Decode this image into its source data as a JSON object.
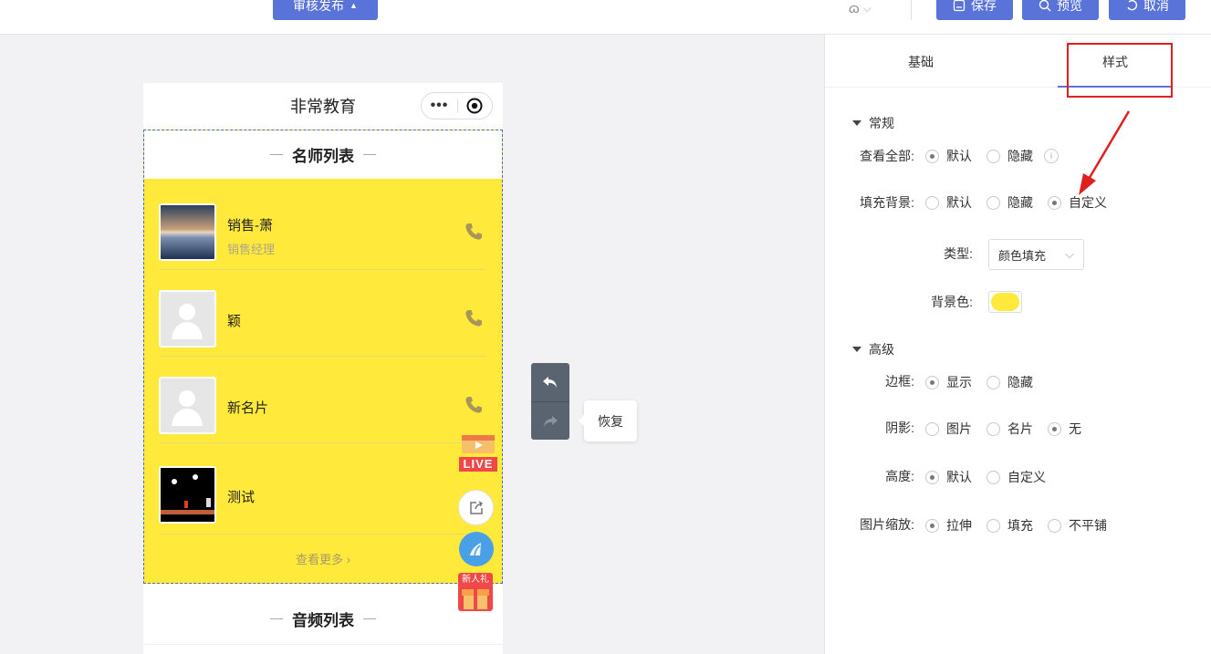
{
  "topbar": {
    "review_publish_label": "审核发布",
    "save_label": "保存",
    "preview_label": "预览",
    "cancel_label": "取消"
  },
  "phone": {
    "title": "非常教育",
    "capsule_dots": "•••"
  },
  "teacher_module": {
    "title": "名师列表",
    "items": [
      {
        "name": "销售-萧",
        "subtitle": "销售经理"
      },
      {
        "name": "颖",
        "subtitle": ""
      },
      {
        "name": "新名片",
        "subtitle": ""
      },
      {
        "name": "测试",
        "subtitle": ""
      }
    ],
    "more_label": "查看更多"
  },
  "audio_module": {
    "title": "音频列表"
  },
  "floating": {
    "live_label": "LIVE",
    "gift_label": "新人礼"
  },
  "undo_tooltip": "恢复",
  "panel": {
    "tabs": [
      "基础",
      "样式"
    ],
    "active_tab": "样式",
    "general_section": "常规",
    "view_all_label": "查看全部:",
    "view_all_options": [
      "默认",
      "隐藏"
    ],
    "view_all_selected": "默认",
    "fill_bg_label": "填充背景:",
    "fill_bg_options": [
      "默认",
      "隐藏",
      "自定义"
    ],
    "fill_bg_selected": "自定义",
    "type_label": "类型:",
    "type_value": "颜色填充",
    "bg_color_label": "背景色:",
    "bg_color": "#ffe93a",
    "advanced_section": "高级",
    "border_label": "边框:",
    "border_options": [
      "显示",
      "隐藏"
    ],
    "border_selected": "显示",
    "shadow_label": "阴影:",
    "shadow_options": [
      "图片",
      "名片",
      "无"
    ],
    "shadow_selected": "无",
    "height_label": "高度:",
    "height_options": [
      "默认",
      "自定义"
    ],
    "height_selected": "默认",
    "scale_label": "图片缩放:",
    "scale_options": [
      "拉伸",
      "填充",
      "不平铺"
    ],
    "scale_selected": "拉伸"
  },
  "colors": {
    "accent": "#5a73d8",
    "module_bg": "#ffe93a",
    "highlight": "#e02020"
  }
}
